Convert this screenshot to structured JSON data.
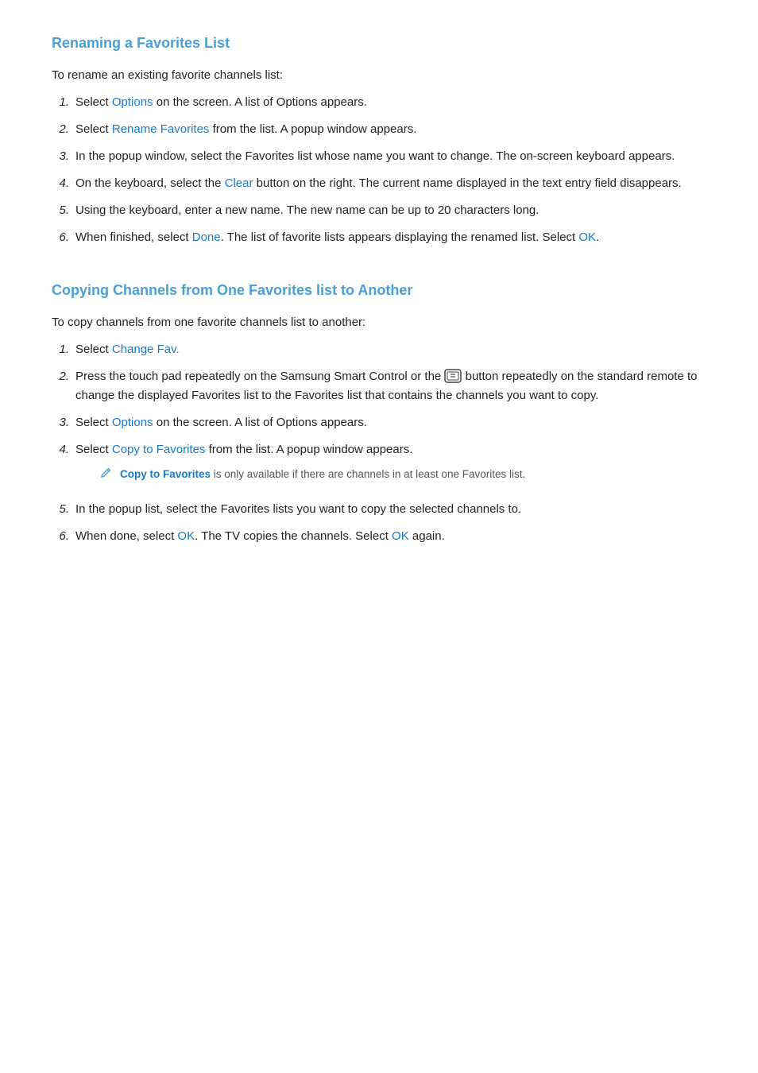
{
  "section1": {
    "title": "Renaming a Favorites List",
    "intro": "To rename an existing favorite channels list:",
    "steps": [
      {
        "num": "1.",
        "parts": [
          {
            "text": "Select ",
            "type": "normal"
          },
          {
            "text": "Options",
            "type": "blue"
          },
          {
            "text": " on the screen. A list of Options appears.",
            "type": "normal"
          }
        ]
      },
      {
        "num": "2.",
        "parts": [
          {
            "text": "Select ",
            "type": "normal"
          },
          {
            "text": "Rename Favorites",
            "type": "blue"
          },
          {
            "text": " from the list. A popup window appears.",
            "type": "normal"
          }
        ]
      },
      {
        "num": "3.",
        "parts": [
          {
            "text": "In the popup window, select the Favorites list whose name you want to change. The on-screen keyboard appears.",
            "type": "normal"
          }
        ]
      },
      {
        "num": "4.",
        "parts": [
          {
            "text": "On the keyboard, select the ",
            "type": "normal"
          },
          {
            "text": "Clear",
            "type": "blue"
          },
          {
            "text": " button on the right. The current name displayed in the text entry field disappears.",
            "type": "normal"
          }
        ]
      },
      {
        "num": "5.",
        "parts": [
          {
            "text": "Using the keyboard, enter a new name. The new name can be up to 20 characters long.",
            "type": "normal"
          }
        ]
      },
      {
        "num": "6.",
        "parts": [
          {
            "text": "When finished, select ",
            "type": "normal"
          },
          {
            "text": "Done",
            "type": "blue"
          },
          {
            "text": ". The list of favorite lists appears displaying the renamed list. Select ",
            "type": "normal"
          },
          {
            "text": "OK",
            "type": "blue"
          },
          {
            "text": ".",
            "type": "normal"
          }
        ]
      }
    ]
  },
  "section2": {
    "title": "Copying Channels from One Favorites list to Another",
    "intro": "To copy channels from one favorite channels list to another:",
    "steps": [
      {
        "num": "1.",
        "parts": [
          {
            "text": "Select ",
            "type": "normal"
          },
          {
            "text": "Change Fav.",
            "type": "blue"
          }
        ]
      },
      {
        "num": "2.",
        "parts": [
          {
            "text": "Press the touch pad repeatedly on the Samsung Smart Control or the ",
            "type": "normal"
          },
          {
            "text": "REMOTE_ICON",
            "type": "icon"
          },
          {
            "text": " button repeatedly on the standard remote to change the displayed Favorites list to the Favorites list that contains the channels you want to copy.",
            "type": "normal"
          }
        ]
      },
      {
        "num": "3.",
        "parts": [
          {
            "text": "Select ",
            "type": "normal"
          },
          {
            "text": "Options",
            "type": "blue"
          },
          {
            "text": " on the screen. A list of Options appears.",
            "type": "normal"
          }
        ]
      },
      {
        "num": "4.",
        "parts": [
          {
            "text": "Select ",
            "type": "normal"
          },
          {
            "text": "Copy to Favorites",
            "type": "blue"
          },
          {
            "text": " from the list. A popup window appears.",
            "type": "normal"
          }
        ]
      },
      {
        "num": "5.",
        "parts": [
          {
            "text": "In the popup list, select the Favorites lists you want to copy the selected channels to.",
            "type": "normal"
          }
        ]
      },
      {
        "num": "6.",
        "parts": [
          {
            "text": "When done, select ",
            "type": "normal"
          },
          {
            "text": "OK",
            "type": "blue"
          },
          {
            "text": ". The TV copies the channels. Select ",
            "type": "normal"
          },
          {
            "text": "OK",
            "type": "blue"
          },
          {
            "text": " again.",
            "type": "normal"
          }
        ]
      }
    ],
    "note": {
      "boldText": "Copy to Favorites",
      "restText": " is only available if there are channels in at least one Favorites list."
    }
  }
}
